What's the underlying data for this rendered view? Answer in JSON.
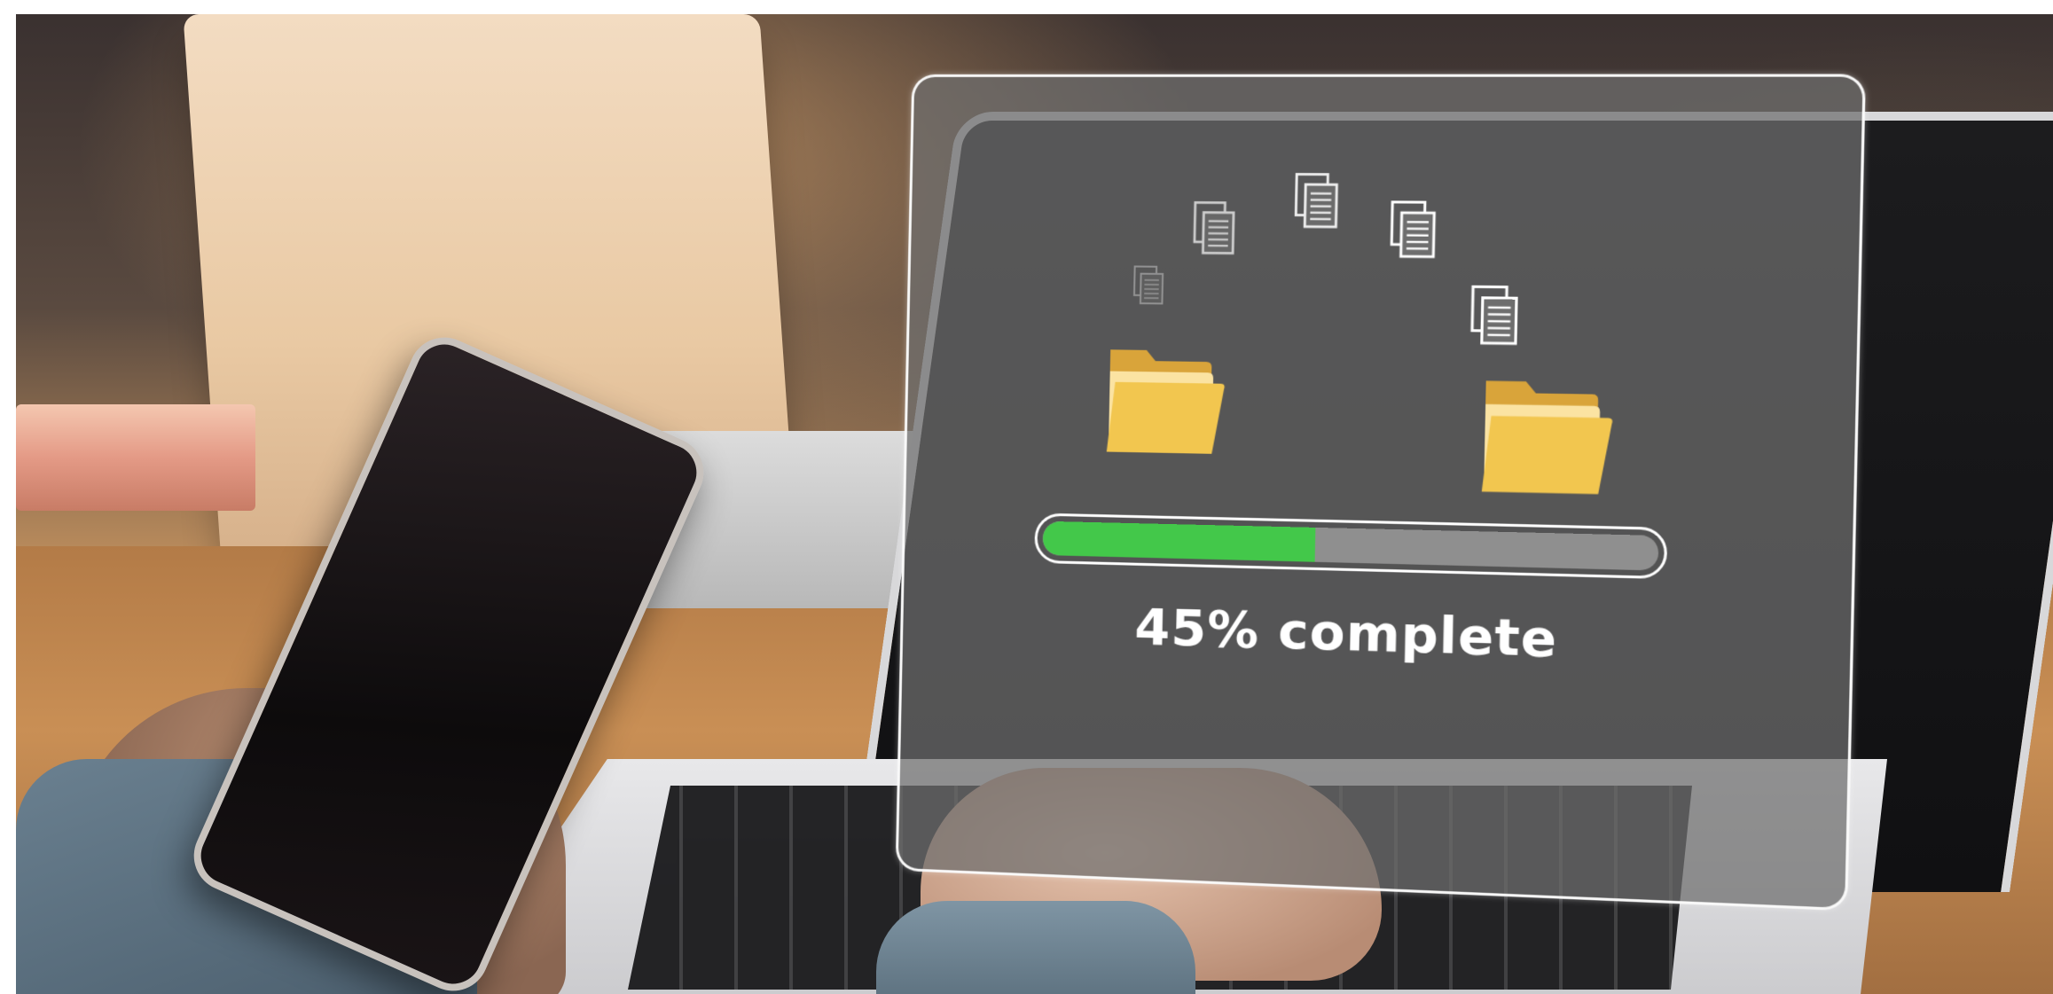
{
  "progress": {
    "label": "45% complete",
    "value_percent": 45,
    "fill_color": "#43c84a",
    "track_color": "#8f8f8f"
  },
  "icons": {
    "document": "document-icon",
    "folder": "folder-icon"
  },
  "colors": {
    "folder_back": "#d9a43a",
    "folder_front": "#f2c64f",
    "panel_border": "#ffffff"
  }
}
